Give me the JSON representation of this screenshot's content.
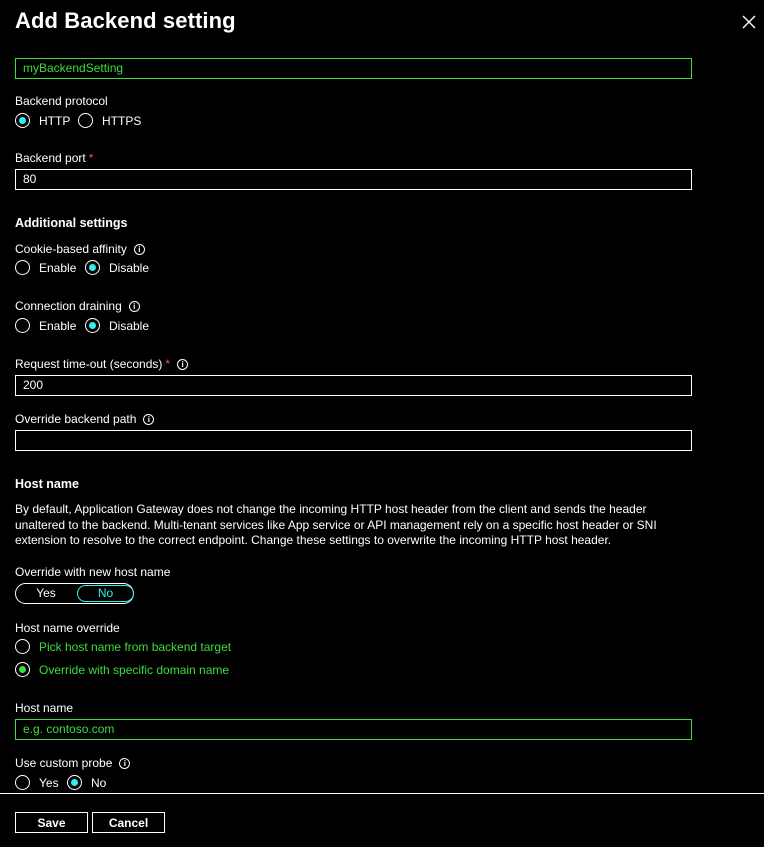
{
  "title": "Add Backend setting",
  "name_value": "myBackendSetting",
  "backend_protocol": {
    "label": "Backend protocol",
    "options": [
      "HTTP",
      "HTTPS"
    ],
    "selected": "HTTP"
  },
  "backend_port": {
    "label": "Backend port",
    "required_mark": "*",
    "value": "80"
  },
  "additional_settings": "Additional settings",
  "cookie_affinity": {
    "label": "Cookie-based affinity",
    "info": "i",
    "options": [
      "Enable",
      "Disable"
    ],
    "selected": "Disable"
  },
  "connection_draining": {
    "label": "Connection draining",
    "info": "i",
    "options": [
      "Enable",
      "Disable"
    ],
    "selected": "Disable"
  },
  "request_timeout": {
    "label": "Request time-out (seconds)",
    "required_mark": "*",
    "info": "i",
    "value": "200"
  },
  "override_path": {
    "label": "Override backend path",
    "info": "i",
    "value": ""
  },
  "host_name_section": {
    "title": "Host name",
    "description": "By default, Application Gateway does not change the incoming HTTP host header from the client and sends the header unaltered to the backend. Multi-tenant services like App service or API management rely on a specific host header or SNI extension to resolve to the correct endpoint. Change these settings to overwrite the incoming HTTP host header."
  },
  "override_host": {
    "label": "Override with new host name",
    "yes": "Yes",
    "no": "No",
    "selected": "No"
  },
  "host_name_override": {
    "label": "Host name override",
    "option_pick": "Pick host name from backend target",
    "option_specific": "Override with specific domain name",
    "selected": "Override with specific domain name"
  },
  "host_name": {
    "label": "Host name",
    "placeholder": "e.g. contoso.com"
  },
  "custom_probe": {
    "label": "Use custom probe",
    "info": "i",
    "options": [
      "Yes",
      "No"
    ],
    "selected": "No"
  },
  "footer": {
    "save": "Save",
    "cancel": "Cancel"
  },
  "colors": {
    "accent": "#2ff0f0",
    "valid": "#3cdc3c",
    "required": "#ff4d4d",
    "background": "#000000"
  },
  "icons": {
    "close": "close-icon",
    "info": "info-icon"
  }
}
